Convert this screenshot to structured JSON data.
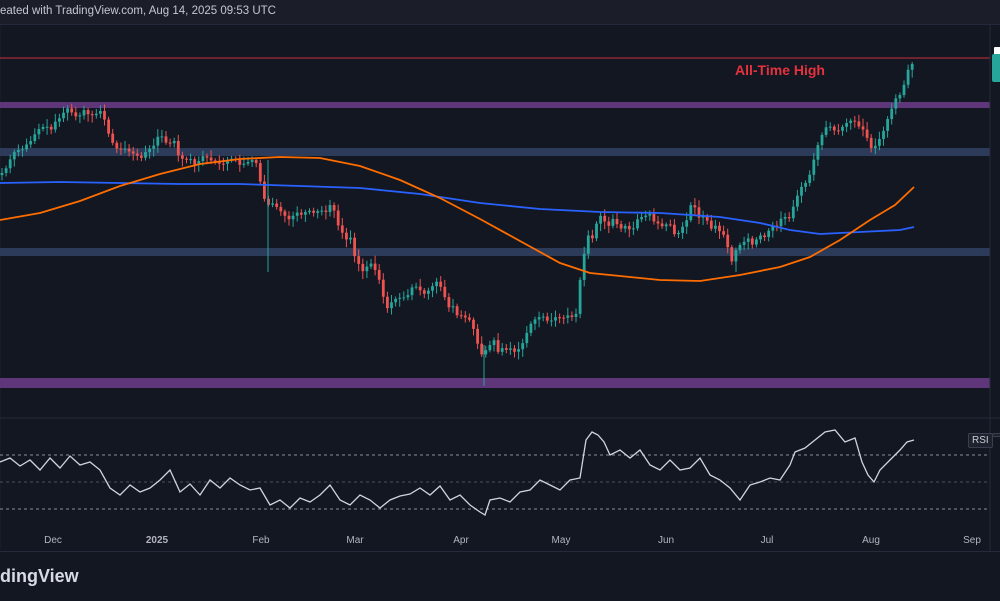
{
  "header": {
    "text": "eated with TradingView.com, Aug 14, 2025 09:53 UTC"
  },
  "footer": {
    "brand": "dingView"
  },
  "colors": {
    "background": "#131722",
    "bull": "#26a69a",
    "bear": "#ef5350",
    "ema_blue": "#2962ff",
    "ema_orange": "#ff6d00",
    "zone_purple": "#6a3a8c",
    "zone_blue": "#2e3d5c",
    "ath_line": "#e5323d",
    "rsi_line": "#d1d4dc"
  },
  "chart_data": [
    {
      "type": "candlestick",
      "title": "",
      "annotations": [
        {
          "text": "All-Time High",
          "color": "#e5323d"
        }
      ],
      "x_ticks": [
        "Dec",
        "2025",
        "Feb",
        "Mar",
        "Apr",
        "May",
        "Jun",
        "Jul",
        "Aug",
        "Sep"
      ],
      "price_path": [
        [
          0,
          175
        ],
        [
          6,
          172
        ],
        [
          10,
          165
        ],
        [
          14,
          155
        ],
        [
          18,
          150
        ],
        [
          24,
          150
        ],
        [
          28,
          145
        ],
        [
          34,
          140
        ],
        [
          38,
          132
        ],
        [
          42,
          128
        ],
        [
          48,
          126
        ],
        [
          54,
          130
        ],
        [
          58,
          120
        ],
        [
          62,
          118
        ],
        [
          66,
          112
        ],
        [
          70,
          108
        ],
        [
          76,
          115
        ],
        [
          80,
          118
        ],
        [
          86,
          110
        ],
        [
          92,
          116
        ],
        [
          98,
          114
        ],
        [
          104,
          110
        ],
        [
          108,
          125
        ],
        [
          112,
          138
        ],
        [
          116,
          145
        ],
        [
          120,
          150
        ],
        [
          126,
          148
        ],
        [
          132,
          152
        ],
        [
          138,
          155
        ],
        [
          144,
          158
        ],
        [
          150,
          148
        ],
        [
          154,
          150
        ],
        [
          158,
          140
        ],
        [
          162,
          133
        ],
        [
          166,
          140
        ],
        [
          170,
          145
        ],
        [
          176,
          140
        ],
        [
          180,
          155
        ],
        [
          186,
          160
        ],
        [
          192,
          158
        ],
        [
          196,
          165
        ],
        [
          200,
          162
        ],
        [
          206,
          155
        ],
        [
          212,
          160
        ],
        [
          218,
          162
        ],
        [
          224,
          165
        ],
        [
          230,
          160
        ],
        [
          236,
          158
        ],
        [
          242,
          165
        ],
        [
          248,
          163
        ],
        [
          254,
          160
        ],
        [
          258,
          162
        ],
        [
          262,
          180
        ],
        [
          266,
          198
        ],
        [
          270,
          205
        ],
        [
          274,
          203
        ],
        [
          280,
          208
        ],
        [
          286,
          215
        ],
        [
          292,
          220
        ],
        [
          298,
          212
        ],
        [
          304,
          215
        ],
        [
          310,
          210
        ],
        [
          316,
          213
        ],
        [
          322,
          210
        ],
        [
          328,
          212
        ],
        [
          332,
          205
        ],
        [
          336,
          210
        ],
        [
          340,
          225
        ],
        [
          344,
          232
        ],
        [
          348,
          240
        ],
        [
          352,
          235
        ],
        [
          356,
          255
        ],
        [
          360,
          262
        ],
        [
          364,
          272
        ],
        [
          368,
          268
        ],
        [
          372,
          262
        ],
        [
          376,
          268
        ],
        [
          380,
          275
        ],
        [
          384,
          290
        ],
        [
          388,
          310
        ],
        [
          392,
          305
        ],
        [
          396,
          298
        ],
        [
          400,
          300
        ],
        [
          404,
          295
        ],
        [
          408,
          300
        ],
        [
          412,
          290
        ],
        [
          416,
          285
        ],
        [
          420,
          288
        ],
        [
          424,
          292
        ],
        [
          428,
          295
        ],
        [
          432,
          288
        ],
        [
          436,
          285
        ],
        [
          440,
          280
        ],
        [
          444,
          290
        ],
        [
          448,
          300
        ],
        [
          452,
          310
        ],
        [
          456,
          305
        ],
        [
          460,
          318
        ],
        [
          464,
          315
        ],
        [
          468,
          318
        ],
        [
          472,
          320
        ],
        [
          476,
          330
        ],
        [
          480,
          345
        ],
        [
          484,
          355
        ],
        [
          488,
          350
        ],
        [
          492,
          345
        ],
        [
          496,
          340
        ],
        [
          500,
          352
        ],
        [
          504,
          348
        ],
        [
          508,
          350
        ],
        [
          512,
          348
        ],
        [
          516,
          352
        ],
        [
          520,
          350
        ],
        [
          524,
          345
        ],
        [
          528,
          335
        ],
        [
          532,
          325
        ],
        [
          536,
          320
        ],
        [
          540,
          318
        ],
        [
          544,
          315
        ],
        [
          548,
          320
        ],
        [
          552,
          322
        ],
        [
          556,
          318
        ],
        [
          560,
          316
        ],
        [
          564,
          320
        ],
        [
          568,
          315
        ],
        [
          572,
          316
        ],
        [
          576,
          318
        ],
        [
          580,
          310
        ],
        [
          583,
          268
        ],
        [
          586,
          255
        ],
        [
          590,
          235
        ],
        [
          594,
          240
        ],
        [
          598,
          225
        ],
        [
          602,
          215
        ],
        [
          606,
          220
        ],
        [
          610,
          228
        ],
        [
          614,
          218
        ],
        [
          618,
          222
        ],
        [
          622,
          230
        ],
        [
          626,
          225
        ],
        [
          630,
          228
        ],
        [
          634,
          232
        ],
        [
          638,
          222
        ],
        [
          642,
          215
        ],
        [
          646,
          220
        ],
        [
          650,
          210
        ],
        [
          654,
          218
        ],
        [
          658,
          225
        ],
        [
          662,
          222
        ],
        [
          666,
          230
        ],
        [
          670,
          220
        ],
        [
          674,
          228
        ],
        [
          678,
          238
        ],
        [
          682,
          230
        ],
        [
          686,
          225
        ],
        [
          690,
          218
        ],
        [
          694,
          200
        ],
        [
          698,
          210
        ],
        [
          702,
          220
        ],
        [
          706,
          215
        ],
        [
          710,
          222
        ],
        [
          714,
          230
        ],
        [
          718,
          225
        ],
        [
          722,
          232
        ],
        [
          726,
          235
        ],
        [
          730,
          248
        ],
        [
          734,
          262
        ],
        [
          738,
          250
        ],
        [
          742,
          245
        ],
        [
          746,
          242
        ],
        [
          750,
          238
        ],
        [
          754,
          245
        ],
        [
          758,
          240
        ],
        [
          762,
          235
        ],
        [
          766,
          238
        ],
        [
          770,
          232
        ],
        [
          774,
          225
        ],
        [
          778,
          228
        ],
        [
          782,
          220
        ],
        [
          786,
          215
        ],
        [
          790,
          222
        ],
        [
          794,
          210
        ],
        [
          798,
          200
        ],
        [
          802,
          188
        ],
        [
          806,
          185
        ],
        [
          810,
          180
        ],
        [
          814,
          168
        ],
        [
          818,
          150
        ],
        [
          822,
          140
        ],
        [
          826,
          130
        ],
        [
          830,
          125
        ],
        [
          834,
          128
        ],
        [
          838,
          132
        ],
        [
          842,
          130
        ],
        [
          846,
          125
        ],
        [
          850,
          122
        ],
        [
          854,
          120
        ],
        [
          858,
          122
        ],
        [
          862,
          128
        ],
        [
          866,
          130
        ],
        [
          870,
          140
        ],
        [
          874,
          150
        ],
        [
          878,
          145
        ],
        [
          882,
          138
        ],
        [
          886,
          130
        ],
        [
          890,
          118
        ],
        [
          894,
          108
        ],
        [
          898,
          98
        ],
        [
          902,
          95
        ],
        [
          906,
          85
        ],
        [
          910,
          70
        ],
        [
          914,
          64
        ]
      ],
      "ema_200_path": [
        [
          0,
          183
        ],
        [
          60,
          182
        ],
        [
          120,
          183
        ],
        [
          180,
          184
        ],
        [
          240,
          184
        ],
        [
          300,
          186
        ],
        [
          360,
          188
        ],
        [
          420,
          194
        ],
        [
          480,
          203
        ],
        [
          540,
          209
        ],
        [
          600,
          212
        ],
        [
          660,
          213
        ],
        [
          720,
          217
        ],
        [
          760,
          223
        ],
        [
          790,
          230
        ],
        [
          820,
          234
        ],
        [
          860,
          232
        ],
        [
          900,
          230
        ],
        [
          914,
          227
        ]
      ],
      "ema_100_path": [
        [
          0,
          220
        ],
        [
          40,
          213
        ],
        [
          80,
          201
        ],
        [
          120,
          186
        ],
        [
          160,
          174
        ],
        [
          200,
          164
        ],
        [
          240,
          159
        ],
        [
          280,
          157
        ],
        [
          320,
          158
        ],
        [
          360,
          166
        ],
        [
          400,
          180
        ],
        [
          440,
          198
        ],
        [
          480,
          219
        ],
        [
          520,
          241
        ],
        [
          560,
          263
        ],
        [
          590,
          273
        ],
        [
          620,
          276
        ],
        [
          660,
          280
        ],
        [
          700,
          281
        ],
        [
          740,
          275
        ],
        [
          780,
          267
        ],
        [
          810,
          257
        ],
        [
          840,
          240
        ],
        [
          870,
          220
        ],
        [
          895,
          205
        ],
        [
          914,
          187
        ]
      ],
      "zones": [
        {
          "name": "resistance-upper",
          "color": "purple"
        },
        {
          "name": "support-1",
          "color": "blue"
        },
        {
          "name": "support-2",
          "color": "blue"
        },
        {
          "name": "support-bottom",
          "color": "purple"
        }
      ]
    },
    {
      "type": "line",
      "title": "RSI",
      "legend_label": "RSI",
      "rsi_path": [
        [
          0,
          462
        ],
        [
          10,
          458
        ],
        [
          20,
          466
        ],
        [
          30,
          460
        ],
        [
          40,
          470
        ],
        [
          50,
          458
        ],
        [
          60,
          468
        ],
        [
          70,
          456
        ],
        [
          80,
          465
        ],
        [
          90,
          462
        ],
        [
          100,
          470
        ],
        [
          110,
          488
        ],
        [
          120,
          495
        ],
        [
          130,
          485
        ],
        [
          140,
          492
        ],
        [
          150,
          488
        ],
        [
          160,
          480
        ],
        [
          170,
          470
        ],
        [
          180,
          492
        ],
        [
          190,
          484
        ],
        [
          200,
          495
        ],
        [
          210,
          480
        ],
        [
          220,
          488
        ],
        [
          230,
          478
        ],
        [
          240,
          485
        ],
        [
          250,
          490
        ],
        [
          260,
          488
        ],
        [
          270,
          505
        ],
        [
          280,
          500
        ],
        [
          290,
          508
        ],
        [
          300,
          498
        ],
        [
          310,
          502
        ],
        [
          320,
          495
        ],
        [
          330,
          485
        ],
        [
          340,
          500
        ],
        [
          350,
          505
        ],
        [
          360,
          495
        ],
        [
          370,
          500
        ],
        [
          380,
          508
        ],
        [
          390,
          500
        ],
        [
          400,
          496
        ],
        [
          410,
          494
        ],
        [
          420,
          488
        ],
        [
          430,
          495
        ],
        [
          440,
          486
        ],
        [
          450,
          500
        ],
        [
          460,
          495
        ],
        [
          470,
          505
        ],
        [
          480,
          512
        ],
        [
          485,
          515
        ],
        [
          490,
          500
        ],
        [
          500,
          498
        ],
        [
          510,
          502
        ],
        [
          520,
          492
        ],
        [
          530,
          490
        ],
        [
          540,
          480
        ],
        [
          550,
          485
        ],
        [
          560,
          490
        ],
        [
          570,
          480
        ],
        [
          580,
          478
        ],
        [
          586,
          440
        ],
        [
          592,
          432
        ],
        [
          598,
          435
        ],
        [
          604,
          442
        ],
        [
          610,
          455
        ],
        [
          620,
          450
        ],
        [
          630,
          458
        ],
        [
          640,
          450
        ],
        [
          650,
          465
        ],
        [
          660,
          470
        ],
        [
          670,
          460
        ],
        [
          680,
          470
        ],
        [
          690,
          468
        ],
        [
          700,
          458
        ],
        [
          710,
          475
        ],
        [
          720,
          480
        ],
        [
          730,
          488
        ],
        [
          740,
          500
        ],
        [
          750,
          485
        ],
        [
          760,
          482
        ],
        [
          770,
          478
        ],
        [
          780,
          480
        ],
        [
          790,
          465
        ],
        [
          795,
          452
        ],
        [
          805,
          448
        ],
        [
          815,
          440
        ],
        [
          825,
          432
        ],
        [
          835,
          430
        ],
        [
          845,
          442
        ],
        [
          855,
          438
        ],
        [
          862,
          462
        ],
        [
          868,
          475
        ],
        [
          874,
          482
        ],
        [
          880,
          470
        ],
        [
          890,
          460
        ],
        [
          900,
          450
        ],
        [
          907,
          442
        ],
        [
          914,
          440
        ]
      ]
    }
  ]
}
